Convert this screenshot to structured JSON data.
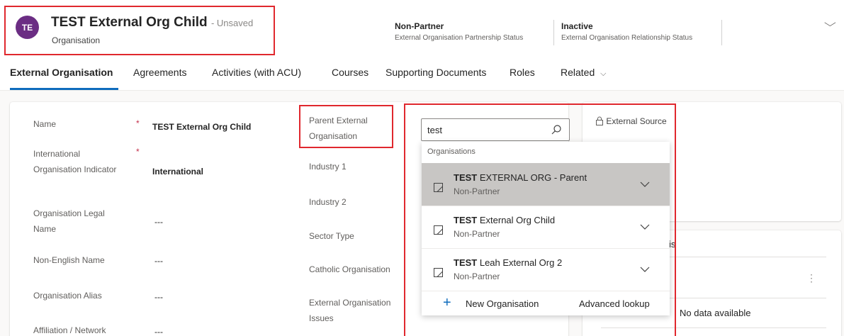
{
  "header": {
    "avatar_initials": "TE",
    "title": "TEST External Org Child",
    "unsaved": "- Unsaved",
    "entity": "Organisation",
    "status1_value": "Non-Partner",
    "status1_label": "External Organisation Partnership Status",
    "status2_value": "Inactive",
    "status2_label": "External Organisation Relationship Status"
  },
  "tabs": [
    {
      "label": "External Organisation"
    },
    {
      "label": "Agreements"
    },
    {
      "label": "Activities (with ACU)"
    },
    {
      "label": "Courses"
    },
    {
      "label": "Supporting Documents"
    },
    {
      "label": "Roles"
    },
    {
      "label": "Related"
    }
  ],
  "left_fields": [
    {
      "label": "Name",
      "value": "TEST External Org Child"
    },
    {
      "label": "International Organisation Indicator",
      "value": "International"
    },
    {
      "label": "Organisation Legal Name",
      "value": "---"
    },
    {
      "label": "Non-English Name",
      "value": "---"
    },
    {
      "label": "Organisation Alias",
      "value": "---"
    },
    {
      "label": "Affiliation / Network",
      "value": "---"
    }
  ],
  "mid_fields": [
    {
      "label": "Parent External Organisation"
    },
    {
      "label": "Industry 1"
    },
    {
      "label": "Industry 2"
    },
    {
      "label": "Sector Type"
    },
    {
      "label": "Catholic Organisation"
    },
    {
      "label": "External Organisation Issues"
    }
  ],
  "lookup": {
    "search_value": "test",
    "group_header": "Organisations",
    "results": [
      {
        "name_bold": "TEST",
        "name_rest": " EXTERNAL ORG - Parent",
        "sub": "Non-Partner"
      },
      {
        "name_bold": "TEST",
        "name_rest": " External Org Child",
        "sub": "Non-Partner"
      },
      {
        "name_bold": "TEST",
        "name_rest": " Leah External Org 2",
        "sub": "Non-Partner"
      }
    ],
    "new_label": "New Organisation",
    "advanced_label": "Advanced lookup"
  },
  "right_panel": {
    "external_source_label": "External Source",
    "partial_label": "is",
    "no_data": "No data available"
  },
  "colors": {
    "avatar": "#6b2d83",
    "highlight": "#e0282e",
    "accent": "#0f6cbd"
  }
}
